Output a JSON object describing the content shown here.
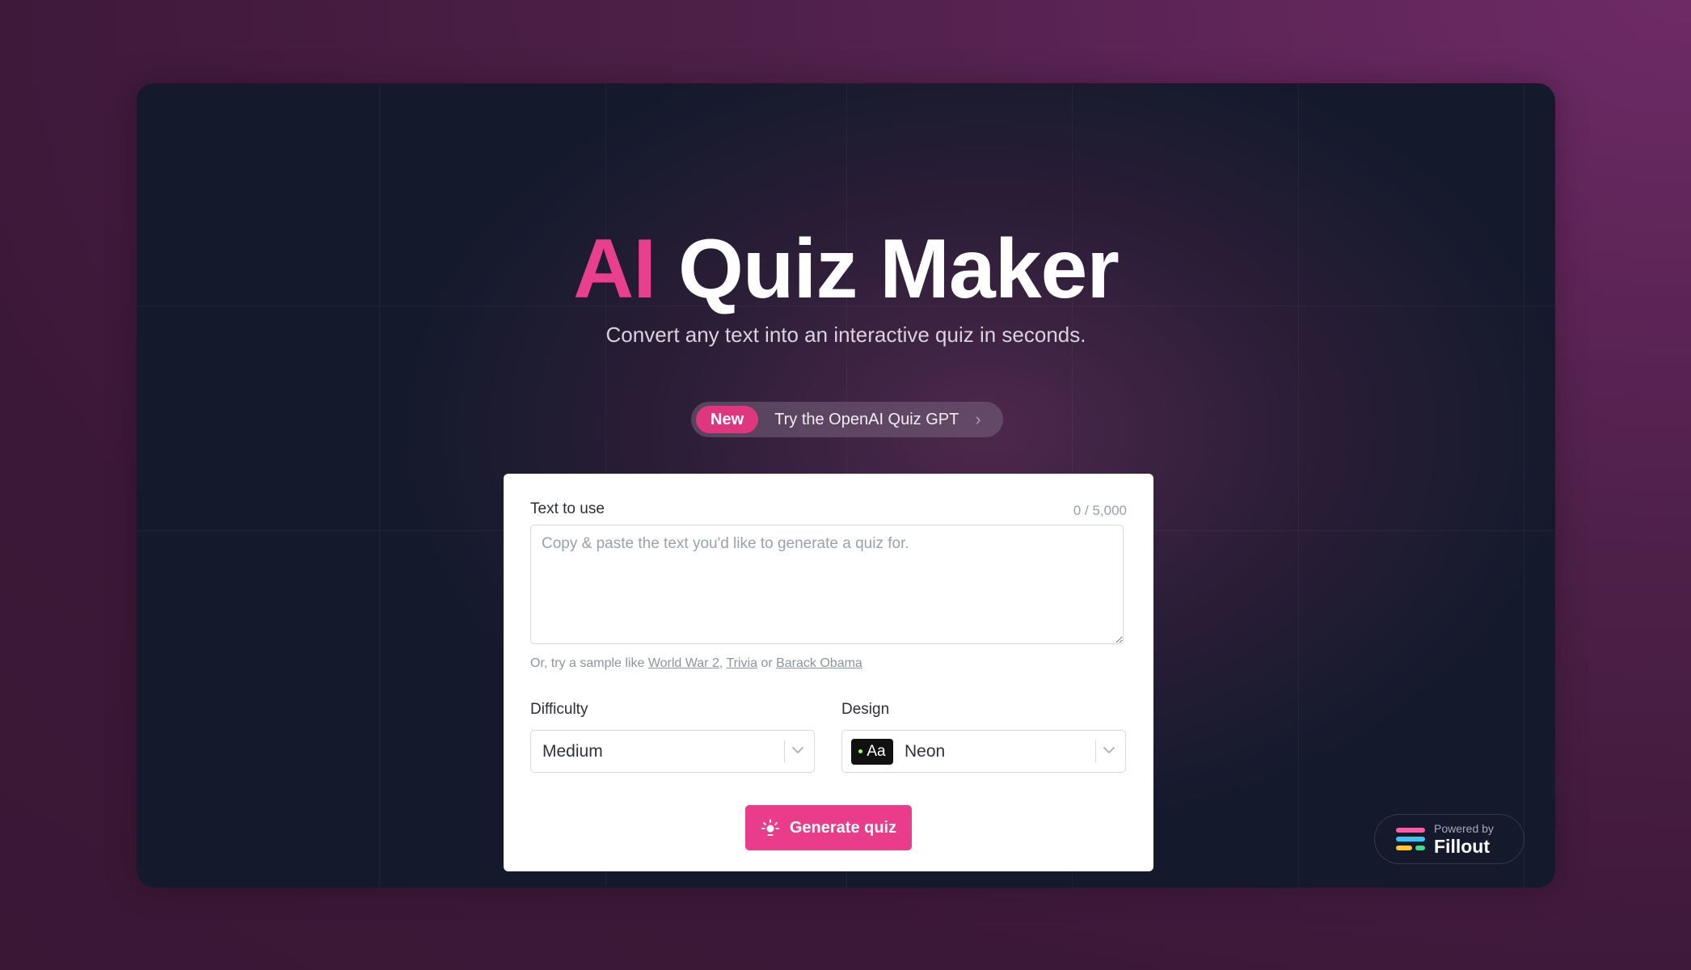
{
  "hero": {
    "title_accent": "AI",
    "title_rest": "Quiz Maker",
    "subtitle": "Convert any text into an interactive quiz in seconds."
  },
  "announcement": {
    "badge": "New",
    "text": "Try the OpenAI Quiz GPT",
    "chevron": "›"
  },
  "form": {
    "text_label": "Text to use",
    "counter": "0 / 5,000",
    "text_value": "",
    "text_placeholder": "Copy & paste the text you'd like to generate a quiz for.",
    "sample_prefix": "Or, try a sample like",
    "samples": [
      "World War 2",
      "Trivia",
      "Barack Obama"
    ],
    "sample_separator": ",",
    "sample_or": "or",
    "difficulty_label": "Difficulty",
    "difficulty_value": "Medium",
    "design_label": "Design",
    "design_value": "Neon",
    "design_swatch_text": "Aa",
    "generate_label": "Generate quiz"
  },
  "footer_badge": {
    "powered_by": "Powered by",
    "brand": "Fillout"
  },
  "colors": {
    "accent": "#e93c8b",
    "badge_pink": "#e0357f",
    "panel_bg": "#141a2c",
    "page_bg": "#4e2049",
    "neon_dot": "#a6ff3b"
  },
  "icons": {
    "generate": "sparkle-icon",
    "select_caret": "chevron-down-icon",
    "announcement_caret": "chevron-right-icon",
    "brand_logo": "fillout-logo-icon"
  }
}
